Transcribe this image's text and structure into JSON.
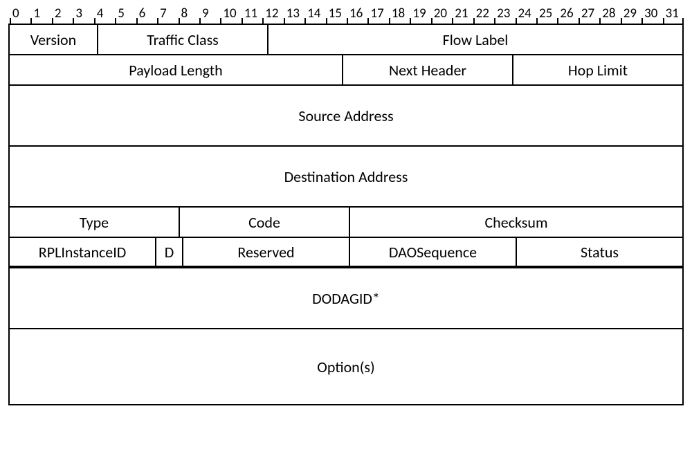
{
  "bits": [
    "0",
    "1",
    "2",
    "3",
    "4",
    "5",
    "6",
    "7",
    "8",
    "9",
    "10",
    "11",
    "12",
    "13",
    "14",
    "15",
    "16",
    "17",
    "18",
    "19",
    "20",
    "21",
    "22",
    "23",
    "24",
    "25",
    "26",
    "27",
    "28",
    "29",
    "30",
    "31"
  ],
  "rows": {
    "r1": {
      "version": "Version",
      "traffic": "Traffic Class",
      "flow": "Flow Label"
    },
    "r2": {
      "payload": "Payload Length",
      "next": "Next Header",
      "hop": "Hop Limit"
    },
    "r3": {
      "src": "Source Address"
    },
    "r4": {
      "dst": "Destination Address"
    },
    "r5": {
      "type": "Type",
      "code": "Code",
      "cksum": "Checksum"
    },
    "r6": {
      "inst": "RPLInstanceID",
      "d": "D",
      "resv": "Reserved",
      "seq": "DAOSequence",
      "status": "Status"
    },
    "r7": {
      "dodag": "DODAGID*"
    },
    "r8": {
      "opts": "Option(s)"
    }
  }
}
